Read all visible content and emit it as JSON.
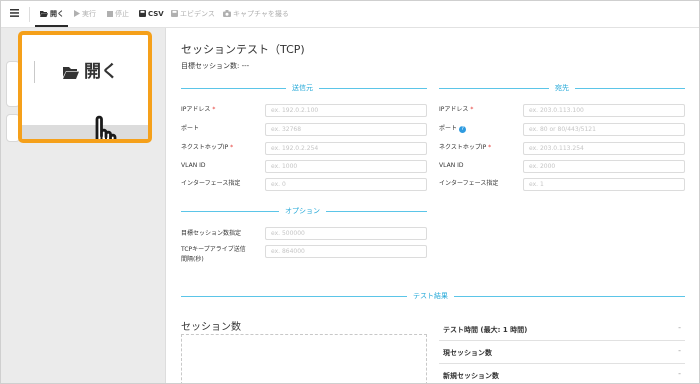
{
  "toolbar": {
    "menu_icon": "hamburger-icon",
    "open": "開く",
    "run": "実行",
    "stop": "停止",
    "csv": "CSV",
    "evidence": "エビデンス",
    "capture": "キャプチャを撮る"
  },
  "callout": {
    "open_label": "開く",
    "icon": "folder-open-icon",
    "pointer": "hand-pointer-icon"
  },
  "main": {
    "title": "セッションテスト（TCP)",
    "target_sessions_label": "目標セッション数:",
    "target_sessions_value": "---"
  },
  "source": {
    "title": "送信元",
    "ip_label": "IPアドレス",
    "ip_placeholder": "ex. 192.0.2.100",
    "port_label": "ポート",
    "port_placeholder": "ex. 32768",
    "nexthop_label": "ネクストホップIP",
    "nexthop_placeholder": "ex. 192.0.2.254",
    "vlan_label": "VLAN ID",
    "vlan_placeholder": "ex. 1000",
    "iface_label": "インターフェース指定",
    "iface_placeholder": "ex. 0"
  },
  "destination": {
    "title": "宛先",
    "ip_label": "IPアドレス",
    "ip_placeholder": "ex. 203.0.113.100",
    "port_label": "ポート",
    "port_placeholder": "ex. 80 or 80/443/5121",
    "nexthop_label": "ネクストホップIP",
    "nexthop_placeholder": "ex. 203.0.113.254",
    "vlan_label": "VLAN ID",
    "vlan_placeholder": "ex. 2000",
    "iface_label": "インターフェース指定",
    "iface_placeholder": "ex. 1"
  },
  "required_mark": "*",
  "info_mark": "?",
  "options": {
    "title": "オプション",
    "target_label": "目標セッション数指定",
    "target_placeholder": "ex. 500000",
    "keepalive_label_1": "TCPキープアライブ送信",
    "keepalive_label_2": "間隔(秒)",
    "keepalive_placeholder": "ex. 864000"
  },
  "results": {
    "title": "テスト結果",
    "chart_title": "セッション数",
    "items": [
      {
        "label": "テスト時間 (最大: 1 時間)",
        "toggle": "-"
      },
      {
        "label": "現セッション数",
        "toggle": "-"
      },
      {
        "label": "新規セッション数",
        "toggle": "-"
      }
    ]
  },
  "colors": {
    "accent": "#23a8d8",
    "callout_border": "#f5a01a",
    "required": "#e53935"
  }
}
